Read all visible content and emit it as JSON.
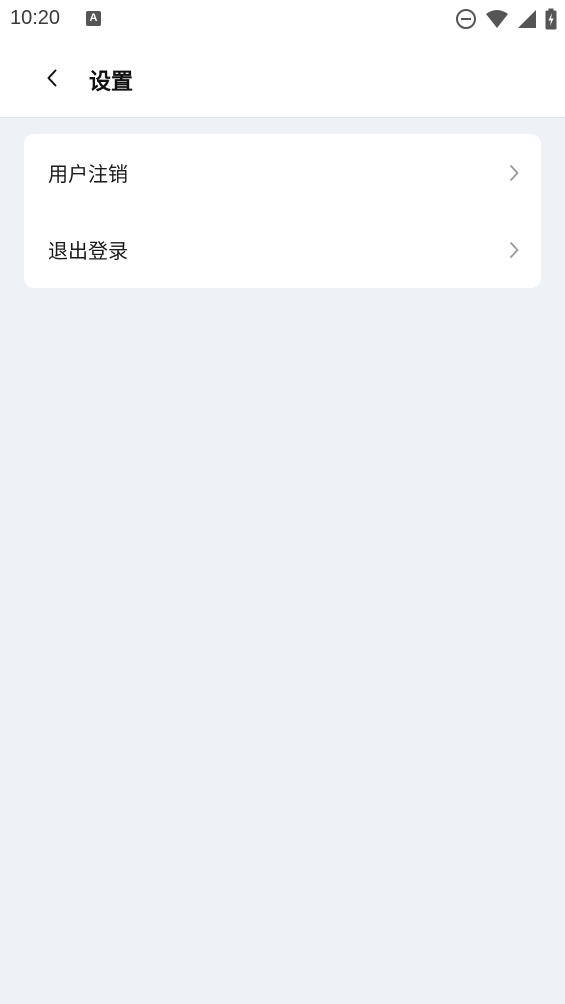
{
  "status_bar": {
    "time": "10:20",
    "notification_icon_letter": "A",
    "icons": [
      "do-not-disturb-icon",
      "wifi-icon",
      "signal-icon",
      "battery-charging-icon"
    ]
  },
  "header": {
    "title": "设置",
    "back_icon": "chevron-left-icon"
  },
  "settings": {
    "items": [
      {
        "label": "用户注销",
        "icon": "chevron-right-icon"
      },
      {
        "label": "退出登录",
        "icon": "chevron-right-icon"
      }
    ]
  },
  "colors": {
    "background": "#eef2f6",
    "surface": "#ffffff",
    "text_primary": "#1a1a1a",
    "chevron": "#9a9a9a"
  }
}
